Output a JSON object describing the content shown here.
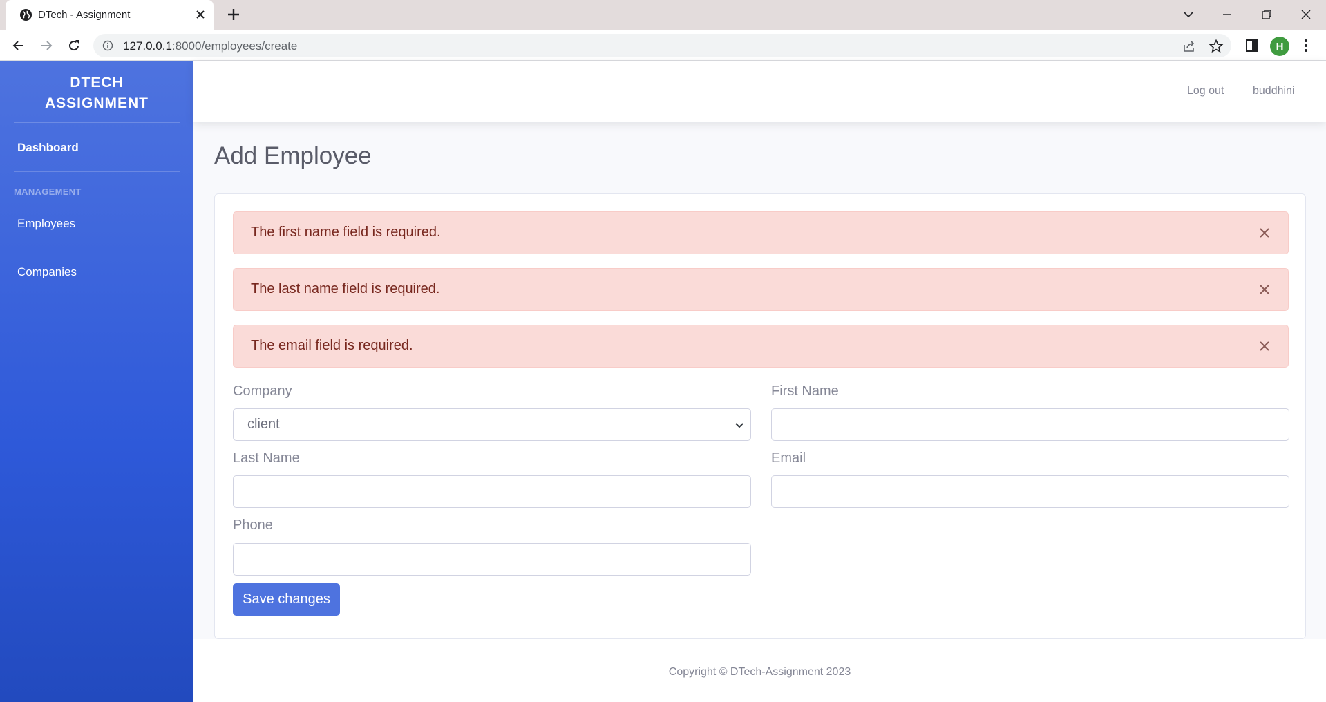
{
  "browser": {
    "tab_title": "DTech - Assignment",
    "url_host": "127.0.0.1",
    "url_path": ":8000/employees/create",
    "profile_initial": "H"
  },
  "sidebar": {
    "brand_line1": "DTECH",
    "brand_line2": "ASSIGNMENT",
    "dashboard": "Dashboard",
    "heading": "MANAGEMENT",
    "items": [
      {
        "label": "Employees"
      },
      {
        "label": "Companies"
      }
    ]
  },
  "topbar": {
    "logout": "Log out",
    "user": "buddhini"
  },
  "page": {
    "title": "Add Employee"
  },
  "alerts": [
    {
      "text": "The first name field is required."
    },
    {
      "text": "The last name field is required."
    },
    {
      "text": "The email field is required."
    }
  ],
  "form": {
    "company_label": "Company",
    "company_value": "client",
    "first_name_label": "First Name",
    "first_name_value": "",
    "last_name_label": "Last Name",
    "last_name_value": "",
    "email_label": "Email",
    "email_value": "",
    "phone_label": "Phone",
    "phone_value": "",
    "save_label": "Save changes"
  },
  "footer": {
    "copyright": "Copyright © DTech-Assignment 2023"
  },
  "colors": {
    "primary": "#4e73df",
    "alert_bg": "#fadbd8",
    "alert_text": "#78281f",
    "profile": "#3f9b3f"
  }
}
